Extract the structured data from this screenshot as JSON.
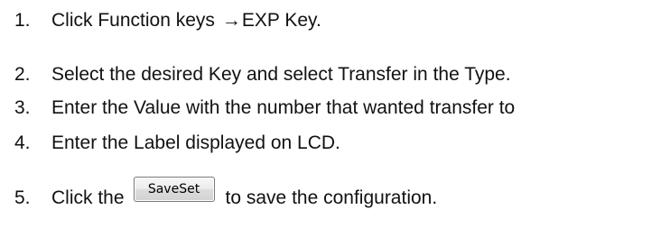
{
  "steps": [
    {
      "number": "1.",
      "text_before": "Click Function keys",
      "arrow": "→",
      "text_after": "EXP Key."
    },
    {
      "number": "2.",
      "text": "Select the desired Key and select Transfer in the Type."
    },
    {
      "number": "3.",
      "text": "Enter the Value with the number that wanted transfer to"
    },
    {
      "number": "4.",
      "text": "Enter the Label displayed on LCD."
    },
    {
      "number": "5.",
      "text_before": "Click the",
      "button_label": "SaveSet",
      "text_after": "to save the configuration."
    }
  ]
}
